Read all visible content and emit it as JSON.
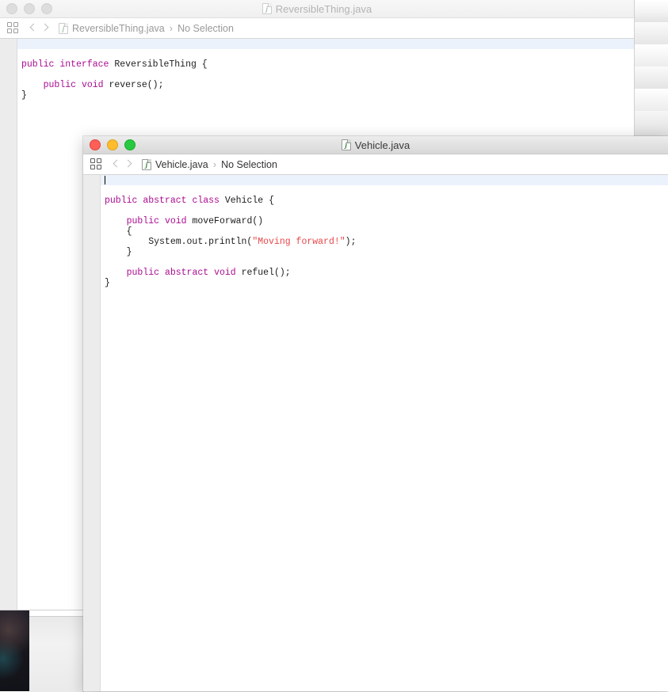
{
  "desktop": {
    "wallpaper_label": "desktop-wallpaper",
    "background_windows": [
      {
        "label": "background-window-right"
      },
      {
        "label": "background-window-lower-right"
      },
      {
        "label": "background-window-bottom-left"
      }
    ]
  },
  "back_window": {
    "state": "inactive",
    "title": "ReversibleThing.java",
    "title_icon": "java-file-icon",
    "traffic_lights": {
      "close": "close-button",
      "minimize": "minimize-button",
      "maximize": "maximize-button"
    },
    "breadcrumb": {
      "grid_icon": "related-items-icon",
      "back_icon": "navigate-back-icon",
      "forward_icon": "navigate-forward-icon",
      "file_icon": "java-file-icon",
      "file": "ReversibleThing.java",
      "separator": "›",
      "selection": "No Selection"
    },
    "code": {
      "lines": [
        {
          "tokens": [
            {
              "t": "",
              "c": "plain"
            }
          ]
        },
        {
          "tokens": [
            {
              "t": "public",
              "c": "kw"
            },
            {
              "t": " ",
              "c": "plain"
            },
            {
              "t": "interface",
              "c": "kw"
            },
            {
              "t": " ",
              "c": "plain"
            },
            {
              "t": "ReversibleThing",
              "c": "id"
            },
            {
              "t": " {",
              "c": "id"
            }
          ]
        },
        {
          "tokens": [
            {
              "t": "",
              "c": "plain"
            }
          ]
        },
        {
          "tokens": [
            {
              "t": "    ",
              "c": "plain"
            },
            {
              "t": "public",
              "c": "kw"
            },
            {
              "t": " ",
              "c": "plain"
            },
            {
              "t": "void",
              "c": "kw"
            },
            {
              "t": " ",
              "c": "plain"
            },
            {
              "t": "reverse();",
              "c": "id"
            }
          ]
        },
        {
          "tokens": [
            {
              "t": "}",
              "c": "id"
            }
          ]
        }
      ]
    }
  },
  "front_window": {
    "state": "active",
    "title": "Vehicle.java",
    "title_icon": "java-file-icon",
    "traffic_lights": {
      "close": "close-button",
      "minimize": "minimize-button",
      "maximize": "maximize-button"
    },
    "breadcrumb": {
      "grid_icon": "related-items-icon",
      "back_icon": "navigate-back-icon",
      "forward_icon": "navigate-forward-icon",
      "file_icon": "java-file-icon",
      "file": "Vehicle.java",
      "separator": "›",
      "selection": "No Selection"
    },
    "code": {
      "caret_line": 1,
      "lines": [
        {
          "tokens": [
            {
              "t": "",
              "c": "plain"
            }
          ]
        },
        {
          "tokens": [
            {
              "t": "public",
              "c": "kw"
            },
            {
              "t": " ",
              "c": "plain"
            },
            {
              "t": "abstract",
              "c": "kw"
            },
            {
              "t": " ",
              "c": "plain"
            },
            {
              "t": "class",
              "c": "kw"
            },
            {
              "t": " ",
              "c": "plain"
            },
            {
              "t": "Vehicle",
              "c": "id"
            },
            {
              "t": " {",
              "c": "id"
            }
          ]
        },
        {
          "tokens": [
            {
              "t": "",
              "c": "plain"
            }
          ]
        },
        {
          "tokens": [
            {
              "t": "    ",
              "c": "plain"
            },
            {
              "t": "public",
              "c": "kw"
            },
            {
              "t": " ",
              "c": "plain"
            },
            {
              "t": "void",
              "c": "kw"
            },
            {
              "t": " ",
              "c": "plain"
            },
            {
              "t": "moveForward()",
              "c": "id"
            }
          ]
        },
        {
          "tokens": [
            {
              "t": "    {",
              "c": "id"
            }
          ]
        },
        {
          "tokens": [
            {
              "t": "        System.out.println(",
              "c": "id"
            },
            {
              "t": "\"Moving forward!\"",
              "c": "str"
            },
            {
              "t": ");",
              "c": "id"
            }
          ]
        },
        {
          "tokens": [
            {
              "t": "    }",
              "c": "id"
            }
          ]
        },
        {
          "tokens": [
            {
              "t": "",
              "c": "plain"
            }
          ]
        },
        {
          "tokens": [
            {
              "t": "    ",
              "c": "plain"
            },
            {
              "t": "public",
              "c": "kw"
            },
            {
              "t": " ",
              "c": "plain"
            },
            {
              "t": "abstract",
              "c": "kw"
            },
            {
              "t": " ",
              "c": "plain"
            },
            {
              "t": "void",
              "c": "kw"
            },
            {
              "t": " ",
              "c": "plain"
            },
            {
              "t": "refuel();",
              "c": "id"
            }
          ]
        },
        {
          "tokens": [
            {
              "t": "}",
              "c": "id"
            }
          ]
        }
      ]
    }
  },
  "colors": {
    "keyword": "#aa0d91",
    "string": "#e8484b",
    "identifier": "#1d1d1d",
    "current_line": "#ebf2fc",
    "gutter": "#ececec",
    "traffic_close": "#ff5f57",
    "traffic_min": "#ffbd2e",
    "traffic_max": "#28c940"
  }
}
